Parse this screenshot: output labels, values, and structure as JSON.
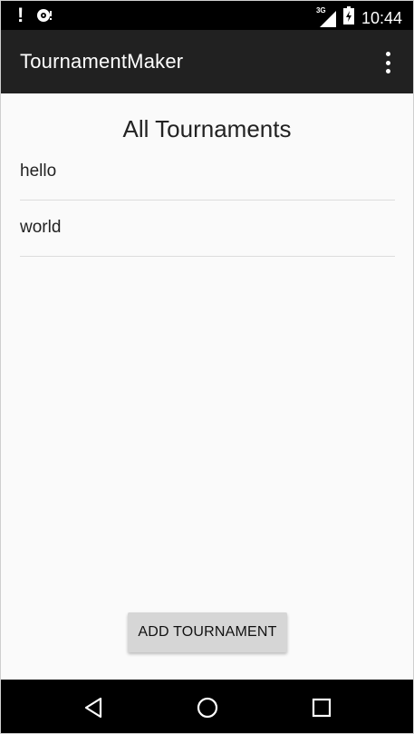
{
  "status_bar": {
    "time": "10:44",
    "network_type": "3G",
    "icons": [
      "alert-icon",
      "notification-icon",
      "signal-icon",
      "battery-icon"
    ]
  },
  "app_bar": {
    "title": "TournamentMaker",
    "overflow_icon": "more-vertical-icon"
  },
  "main": {
    "heading": "All Tournaments",
    "tournaments": [
      {
        "name": "hello"
      },
      {
        "name": "world"
      }
    ],
    "add_button_label": "ADD TOURNAMENT"
  },
  "nav_bar": {
    "buttons": [
      "back-icon",
      "home-icon",
      "recents-icon"
    ]
  },
  "colors": {
    "app_bar": "#212121",
    "background": "#fafafa",
    "button": "#d6d6d6",
    "divider": "#dcdcdc"
  }
}
